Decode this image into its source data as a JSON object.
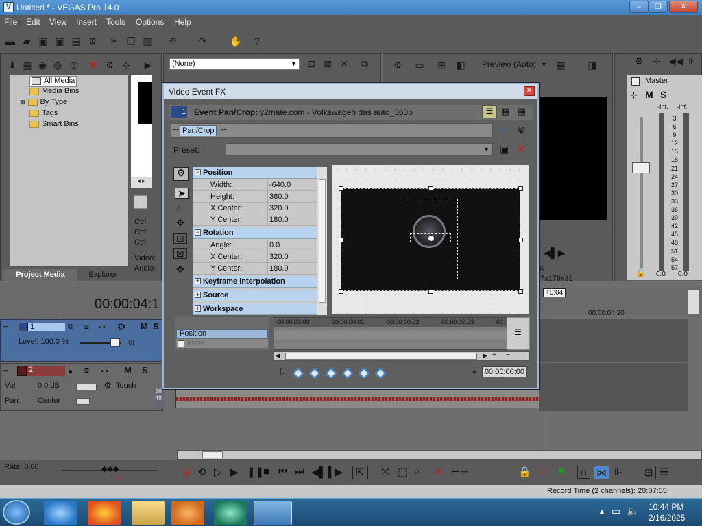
{
  "window": {
    "title": "Untitled * - VEGAS Pro 14.0",
    "app_icon": "V",
    "min": "–",
    "max": "❐",
    "close": "✕"
  },
  "menu": [
    "File",
    "Edit",
    "View",
    "Insert",
    "Tools",
    "Options",
    "Help"
  ],
  "toolbar": {
    "undo_icon": "undo-icon",
    "redo_icon": "redo-icon",
    "help": "?"
  },
  "explorer": {
    "items": [
      "All Media",
      "Media Bins",
      "By Type",
      "Tags",
      "Smart Bins"
    ],
    "tabs": [
      "Project Media",
      "Explorer"
    ],
    "filter": "(None)"
  },
  "trimmer": {
    "ctrl1": "Ctrl",
    "ctrl2": "Ctrl",
    "ctrl3": "Ctrl",
    "video": "Video:",
    "audio": "Audio:"
  },
  "preview": {
    "mode": "Preview (Auto)",
    "res": "7x179x32",
    "frame": "+0:04",
    "num": "6"
  },
  "master": {
    "label": "Master",
    "m": "M",
    "s": "S",
    "inf1": "-Inf.",
    "inf2": "-Inf.",
    "scale": [
      "3",
      "6",
      "9",
      "12",
      "15",
      "18",
      "21",
      "24",
      "27",
      "30",
      "33",
      "36",
      "39",
      "42",
      "45",
      "48",
      "51",
      "54",
      "57"
    ],
    "val1": "0.0",
    "val2": "0.0"
  },
  "timeline": {
    "timecode": "00:00:04:1",
    "ruler_mark": "00:00:04:20",
    "track1": {
      "num": "1",
      "level": "Level: 100.0 %",
      "m": "M",
      "s": "S"
    },
    "track2": {
      "num": "2",
      "vol_label": "Vol:",
      "vol_value": "0.0 dB",
      "pan_label": "Pan:",
      "pan_value": "Center",
      "touch": "Touch",
      "m": "M",
      "s": "S"
    },
    "rate": "Rate: 0.00",
    "record_time": "Record Time (2 channels): 20:07:55",
    "side_nums": [
      "36",
      "48"
    ]
  },
  "fx": {
    "title": "Video Event FX",
    "track_num": "1",
    "header_label": "Event Pan/Crop:",
    "header_value": "y2mate.com - Volkswagen das auto_360p",
    "chain_item": "Pan/Crop",
    "preset_label": "Preset:",
    "position_head": "Position",
    "position": [
      {
        "k": "Width:",
        "v": "-640.0"
      },
      {
        "k": "Height:",
        "v": "360.0"
      },
      {
        "k": "X Center:",
        "v": "320.0"
      },
      {
        "k": "Y Center:",
        "v": "180.0"
      }
    ],
    "rotation_head": "Rotation",
    "rotation": [
      {
        "k": "Angle:",
        "v": "0.0"
      },
      {
        "k": "X Center:",
        "v": "320.0"
      },
      {
        "k": "Y Center:",
        "v": "180.0"
      }
    ],
    "keyframe_head": "Keyframe interpolation",
    "source_head": "Source",
    "workspace_head": "Workspace",
    "kf_track": "Position",
    "kf_mask": "Mask",
    "ruler": [
      "00:00:00:00",
      "00:00:00:01",
      "00:00:00:02",
      "00:00:00:03",
      "00:"
    ],
    "time": "00:00:00:00"
  },
  "taskbar": {
    "time": "10:44 PM",
    "date": "2/16/2025"
  }
}
